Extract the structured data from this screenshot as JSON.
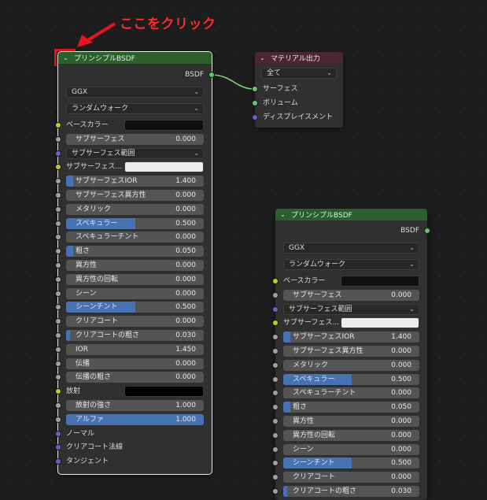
{
  "annotation": {
    "text": "ここをクリック",
    "color": "#ff2a2a"
  },
  "node1": {
    "title": "プリンシプルBSDF",
    "output": "BSDF",
    "distribution": "GGX",
    "subsurface_method": "ランダムウォーク",
    "rows": [
      {
        "type": "color",
        "label": "ベースカラー",
        "socket": "yellow",
        "swatch": "#0f0f0f"
      },
      {
        "type": "slider",
        "label": "サブサーフェス",
        "value": "0.000",
        "fill": 0,
        "socket": "grey"
      },
      {
        "type": "dropdown",
        "label": "サブサーフェス範囲",
        "socket": "purple"
      },
      {
        "type": "color",
        "label": "サブサーフェス...",
        "socket": "yellow",
        "swatch": "#ececec"
      },
      {
        "type": "slider",
        "label": "サブサーフェスIOR",
        "value": "1.400",
        "fill": 0.05,
        "socket": "grey"
      },
      {
        "type": "slider",
        "label": "サブサーフェス異方性",
        "value": "0.000",
        "fill": 0,
        "socket": "grey"
      },
      {
        "type": "slider",
        "label": "メタリック",
        "value": "0.000",
        "fill": 0,
        "socket": "grey"
      },
      {
        "type": "slider",
        "label": "スペキュラー",
        "value": "0.500",
        "fill": 0.5,
        "socket": "grey"
      },
      {
        "type": "slider",
        "label": "スペキュラーチント",
        "value": "0.000",
        "fill": 0,
        "socket": "grey"
      },
      {
        "type": "slider",
        "label": "粗さ",
        "value": "0.050",
        "fill": 0.05,
        "socket": "grey"
      },
      {
        "type": "slider",
        "label": "異方性",
        "value": "0.000",
        "fill": 0,
        "socket": "grey"
      },
      {
        "type": "slider",
        "label": "異方性の回転",
        "value": "0.000",
        "fill": 0,
        "socket": "grey"
      },
      {
        "type": "slider",
        "label": "シーン",
        "value": "0.000",
        "fill": 0,
        "socket": "grey"
      },
      {
        "type": "slider",
        "label": "シーンチント",
        "value": "0.500",
        "fill": 0.5,
        "socket": "grey"
      },
      {
        "type": "slider",
        "label": "クリアコート",
        "value": "0.000",
        "fill": 0,
        "socket": "grey"
      },
      {
        "type": "slider",
        "label": "クリアコートの粗さ",
        "value": "0.030",
        "fill": 0.03,
        "socket": "grey"
      },
      {
        "type": "slider",
        "label": "IOR",
        "value": "1.450",
        "fill": 0,
        "socket": "grey"
      },
      {
        "type": "slider",
        "label": "伝播",
        "value": "0.000",
        "fill": 0,
        "socket": "grey"
      },
      {
        "type": "slider",
        "label": "伝播の粗さ",
        "value": "0.000",
        "fill": 0,
        "socket": "grey"
      },
      {
        "type": "color",
        "label": "放射",
        "socket": "yellow",
        "swatch": "#000000"
      },
      {
        "type": "slider",
        "label": "放射の強さ",
        "value": "1.000",
        "fill": 0,
        "socket": "grey"
      },
      {
        "type": "slider",
        "label": "アルファ",
        "value": "1.000",
        "fill": 1,
        "socket": "grey"
      },
      {
        "type": "plain",
        "label": "ノーマル",
        "socket": "purple"
      },
      {
        "type": "plain",
        "label": "クリアコート法線",
        "socket": "purple"
      },
      {
        "type": "plain",
        "label": "タンジェント",
        "socket": "purple"
      }
    ]
  },
  "node2": {
    "title": "マテリアル出力",
    "target": "全て",
    "inputs": [
      {
        "label": "サーフェス",
        "socket": "green-s"
      },
      {
        "label": "ボリューム",
        "socket": "green-s"
      },
      {
        "label": "ディスプレイスメント",
        "socket": "purple"
      }
    ]
  },
  "node3": {
    "title": "プリンシプルBSDF",
    "output": "BSDF",
    "distribution": "GGX",
    "subsurface_method": "ランダムウォーク",
    "rows": [
      {
        "type": "color",
        "label": "ベースカラー",
        "socket": "yellow",
        "swatch": "#0f0f0f"
      },
      {
        "type": "slider",
        "label": "サブサーフェス",
        "value": "0.000",
        "fill": 0,
        "socket": "grey"
      },
      {
        "type": "dropdown",
        "label": "サブサーフェス範囲",
        "socket": "purple"
      },
      {
        "type": "color",
        "label": "サブサーフェス...",
        "socket": "yellow",
        "swatch": "#ececec"
      },
      {
        "type": "slider",
        "label": "サブサーフェスIOR",
        "value": "1.400",
        "fill": 0.05,
        "socket": "grey"
      },
      {
        "type": "slider",
        "label": "サブサーフェス異方性",
        "value": "0.000",
        "fill": 0,
        "socket": "grey"
      },
      {
        "type": "slider",
        "label": "メタリック",
        "value": "0.000",
        "fill": 0,
        "socket": "grey"
      },
      {
        "type": "slider",
        "label": "スペキュラー",
        "value": "0.500",
        "fill": 0.5,
        "socket": "grey"
      },
      {
        "type": "slider",
        "label": "スペキュラーチント",
        "value": "0.000",
        "fill": 0,
        "socket": "grey"
      },
      {
        "type": "slider",
        "label": "粗さ",
        "value": "0.050",
        "fill": 0.05,
        "socket": "grey"
      },
      {
        "type": "slider",
        "label": "異方性",
        "value": "0.000",
        "fill": 0,
        "socket": "grey"
      },
      {
        "type": "slider",
        "label": "異方性の回転",
        "value": "0.000",
        "fill": 0,
        "socket": "grey"
      },
      {
        "type": "slider",
        "label": "シーン",
        "value": "0.000",
        "fill": 0,
        "socket": "grey"
      },
      {
        "type": "slider",
        "label": "シーンチント",
        "value": "0.500",
        "fill": 0.5,
        "socket": "grey"
      },
      {
        "type": "slider",
        "label": "クリアコート",
        "value": "0.000",
        "fill": 0,
        "socket": "grey"
      },
      {
        "type": "slider",
        "label": "クリアコートの粗さ",
        "value": "0.030",
        "fill": 0.03,
        "socket": "grey"
      }
    ]
  }
}
